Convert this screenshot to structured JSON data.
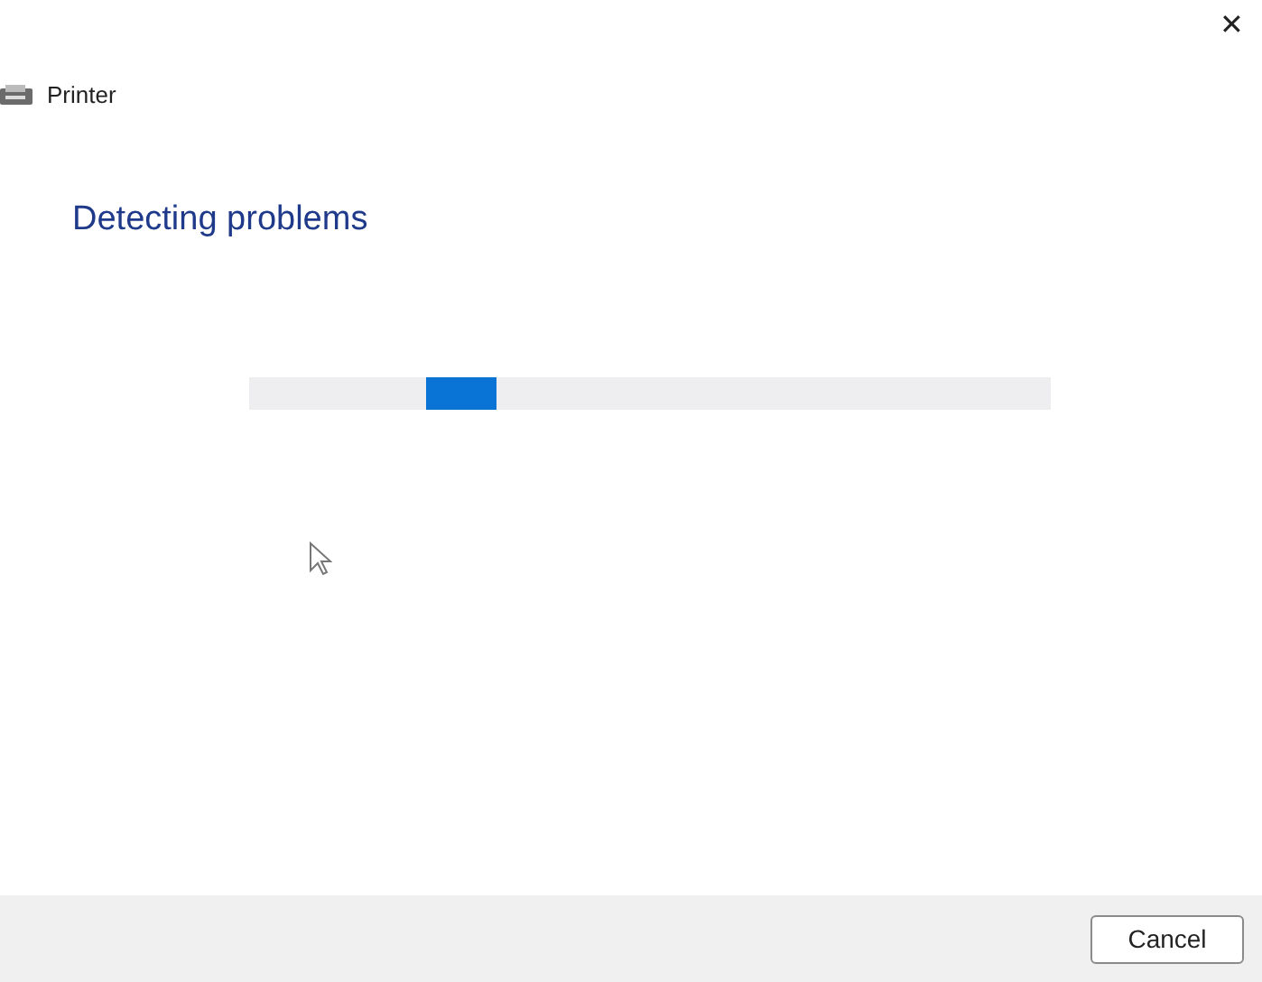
{
  "window": {
    "close_glyph": "✕"
  },
  "header": {
    "title": "Printer"
  },
  "heading": "Detecting problems",
  "progress": {
    "kind": "indeterminate",
    "level": 0.22
  },
  "buttons": [
    "Cancel"
  ]
}
